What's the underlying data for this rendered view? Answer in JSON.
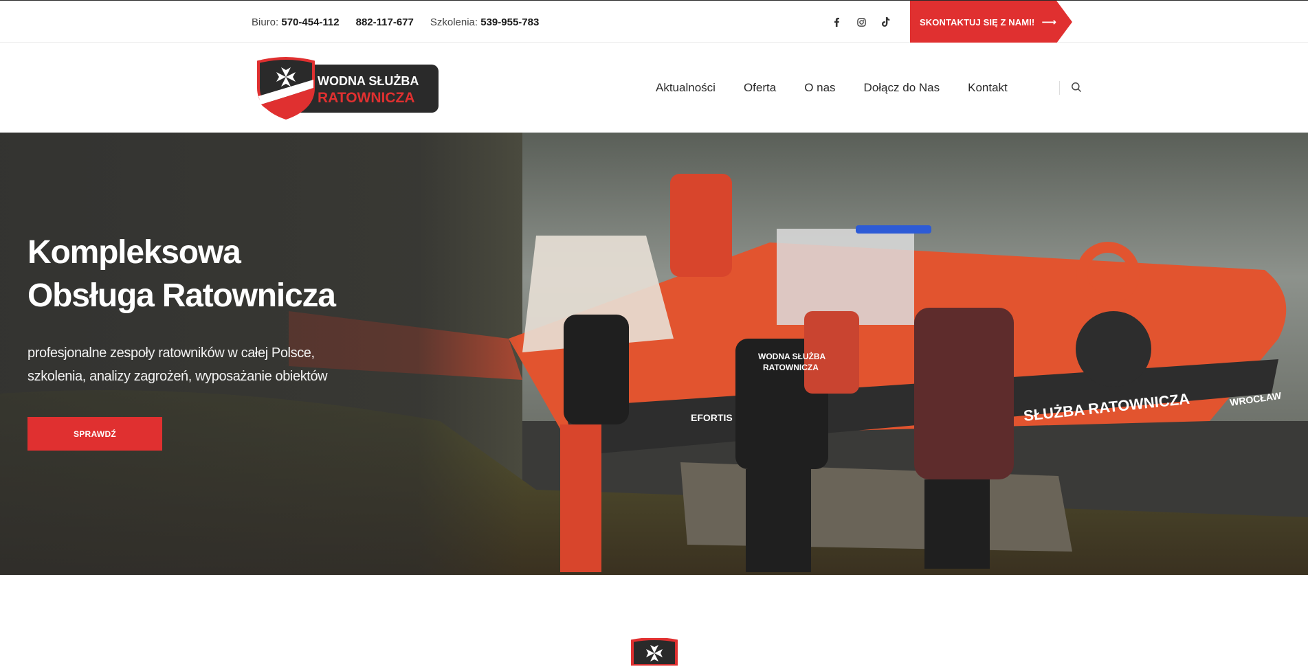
{
  "topbar": {
    "office_label": "Biuro:",
    "office_phone": "570-454-112",
    "second_phone": "882-117-677",
    "training_label": "Szkolenia:",
    "training_phone": "539-955-783",
    "socials": [
      {
        "icon": "facebook-icon"
      },
      {
        "icon": "instagram-icon"
      },
      {
        "icon": "tiktok-icon"
      }
    ],
    "cta_label": "SKONTAKTUJ SIĘ Z NAMI!"
  },
  "logo": {
    "line1": "WODNA SŁUŻBA",
    "line2": "RATOWNICZA"
  },
  "nav": {
    "items": [
      "Aktualności",
      "Oferta",
      "O nas",
      "Dołącz do Nas",
      "Kontakt"
    ],
    "search_icon": "search-icon"
  },
  "hero": {
    "title_line1": "Kompleksowa",
    "title_line2": "Obsługa Ratownicza",
    "sub_line1": "profesjonalne zespoły ratowników w całej Polsce,",
    "sub_line2": "szkolenia, analizy zagrożeń, wyposażanie obiektów",
    "button_label": "SPRAWDŹ",
    "boat_text": "SŁUŻBA RATOWNICZA",
    "boat_text2": "WROCŁAW",
    "boat_brand": "EFORTIS",
    "shirt_text1": "WODNA SŁUŻBA",
    "shirt_text2": "RATOWNICZA"
  },
  "colors": {
    "accent": "#e03030",
    "dark": "#2a2a2a",
    "text": "#2b2b2b"
  }
}
